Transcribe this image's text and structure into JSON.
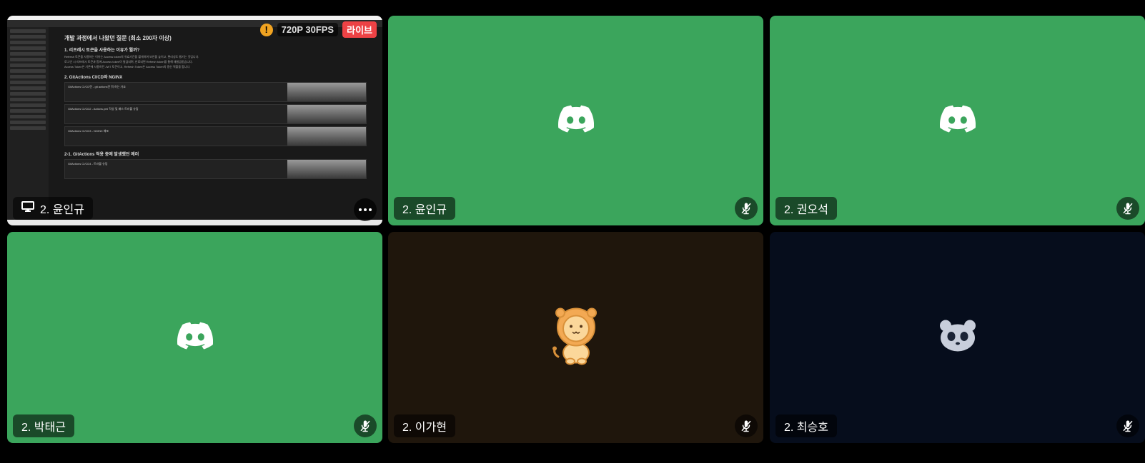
{
  "tiles": [
    {
      "name": "2. 윤인규",
      "type": "screenshare"
    },
    {
      "name": "2. 윤인규",
      "type": "avatar"
    },
    {
      "name": "2. 권오석",
      "type": "avatar"
    },
    {
      "name": "2. 박태근",
      "type": "avatar"
    },
    {
      "name": "2. 이가현",
      "type": "avatar"
    },
    {
      "name": "2. 최승호",
      "type": "avatar"
    }
  ],
  "stream": {
    "warning_glyph": "!",
    "quality": "720P 30FPS",
    "live_label": "라이브"
  },
  "shared_doc": {
    "title": "개발 과정에서 나왔던 질문 (최소 200자 이상)",
    "q1": "1. 리프레시 토큰을 사용하는 이유가 뭘까?",
    "p1": "Refresh 토큰을 사용하는 이유는 Access token의 유효기간을 짧게하여 보안을 높이고, 편리성도 챙기는 것입니다.",
    "p2": "로그인 시 리프레시 토큰과 함께 Access token이 발급되며, 만료되면 Refresh token을 통해 재발급받습니다.",
    "p3": "Access Token은 기존에 사용하던 JWT 토큰이고, Refresh Token은 Access Token의 갱신 역할을 합니다.",
    "q2": "2. GitActions CI/CD와 NGINX",
    "card1": "GitActions CI/CD란 - git actions란 뭐 하는 거죠",
    "card2": "GitActions CI/CD2 - Actions.yml 작성 및 패스 트러블 슈팅",
    "card3": "GitActions CI/CD3 - NGINX 배포",
    "q3": "2-1. GitActions 적용 중에 발생했던 에러",
    "card4": "GitActions CI/CD4 - 트러블 슈팅"
  },
  "colors": {
    "discord_green": "#3ba55c",
    "live_red": "#ed4245",
    "warning_orange": "#f0a321"
  }
}
